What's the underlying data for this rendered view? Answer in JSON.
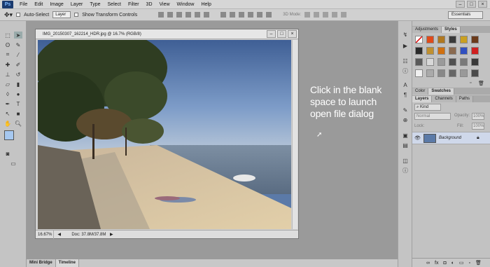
{
  "app": {
    "logo": "Ps"
  },
  "menu": [
    "File",
    "Edit",
    "Image",
    "Layer",
    "Type",
    "Select",
    "Filter",
    "3D",
    "View",
    "Window",
    "Help"
  ],
  "window_controls": [
    "–",
    "□",
    "×"
  ],
  "options": {
    "auto_select": "Auto-Select",
    "layer_dropdown": "Layer",
    "show_transform": "Show Transform Controls",
    "mode3d": "3D Mode:",
    "workspace": "Essentials"
  },
  "document": {
    "title": "IMG_20150307_162214_HDR.jpg @ 16.7% (RGB/8)",
    "zoom": "16.67%",
    "doc_info": "Doc: 37.8M/37.8M"
  },
  "bottom_tabs": [
    "Mini Bridge",
    "Timeline"
  ],
  "instruction": "Click in the blank space to launch open file dialog",
  "panels": {
    "top_tabs": [
      "Adjustments",
      "Styles"
    ],
    "mid_tabs": [
      "Color",
      "Swatches"
    ],
    "layer_tabs": [
      "Layers",
      "Channels",
      "Paths"
    ],
    "kind": "Kind",
    "blend": "Normal",
    "opacity_label": "Opacity:",
    "opacity_value": "100%",
    "lock_label": "Lock:",
    "fill_label": "Fill:",
    "fill_value": "100%",
    "layer_name": "Background"
  },
  "colors": {
    "accent": "#1b3b6f",
    "panel": "#c2c2c2",
    "workspace": "#9a9a9a"
  },
  "icons": {
    "move_tool": "move-icon",
    "lock": "lock-icon",
    "eye": "eye-icon"
  }
}
